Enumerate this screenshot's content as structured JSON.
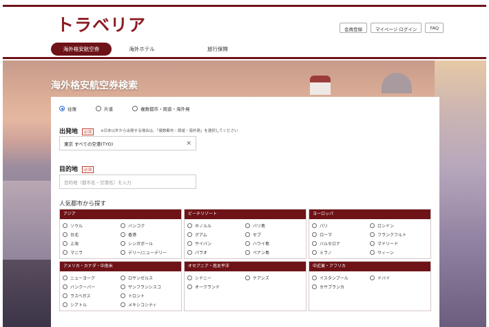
{
  "header": {
    "logo": "トラベリア",
    "links": [
      "会員登録",
      "マイページ ログイン",
      "FAQ"
    ]
  },
  "tabs": [
    "海外格安航空券",
    "海外ホテル",
    "旅行保険"
  ],
  "hero": {
    "title": "海外格安航空券検索"
  },
  "form": {
    "trip_types": [
      "往復",
      "片道",
      "複数都市・周遊・海外発"
    ],
    "origin": {
      "label": "出発地",
      "required": "必須",
      "note": "※日本以外から出発する場合は、「複数都市・周遊・海外発」を選択してください",
      "value": "東京 すべての空港(TYO)",
      "clear": "×"
    },
    "destination": {
      "label": "目的地",
      "required": "必須",
      "placeholder": "目的地（都市名・空港名）を入力"
    },
    "popular_title": "人気都市から探す",
    "regions": [
      {
        "name": "アジア",
        "cities": [
          "ソウル",
          "バンコク",
          "台北",
          "香港",
          "上海",
          "シンガポール",
          "マニラ",
          "デリー/ニューデリー"
        ]
      },
      {
        "name": "ビーチリゾート",
        "cities": [
          "ホノルル",
          "バリ島",
          "グアム",
          "セブ",
          "サイパン",
          "ハワイ島",
          "パラオ",
          "ペナン島"
        ]
      },
      {
        "name": "ヨーロッパ",
        "cities": [
          "パリ",
          "ロンドン",
          "ローマ",
          "フランクフルト",
          "バルセロナ",
          "マドリード",
          "ミラノ",
          "ウィーン"
        ]
      },
      {
        "name": "アメリカ・カナダ・中南米",
        "cities": [
          "ニューヨーク",
          "ロサンゼルス",
          "バンクーバー",
          "サンフランシスコ",
          "ラスベガス",
          "トロント",
          "シアトル",
          "メキシコシティ"
        ]
      },
      {
        "name": "オセアニア・南太平洋",
        "cities": [
          "シドニー",
          "ケアンズ",
          "オークランド"
        ]
      },
      {
        "name": "中近東・アフリカ",
        "cities": [
          "イスタンブール",
          "ドバイ",
          "カサブランカ"
        ]
      }
    ]
  },
  "colors": {
    "brand": "#6e1318",
    "logo": "#8c1d23",
    "radio_selected": "#2a6fd6"
  }
}
